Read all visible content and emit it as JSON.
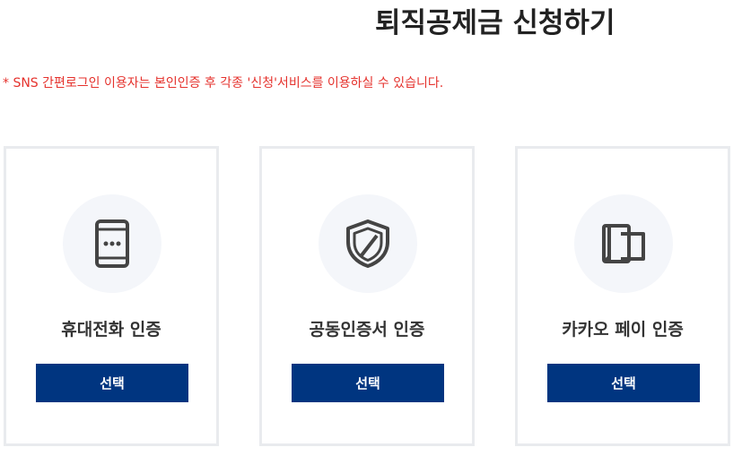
{
  "page": {
    "title": "퇴직공제금 신청하기",
    "notice": "* SNS 간편로그인 이용자는 본인인증 후 각종 '신청'서비스를 이용하실 수 있습니다."
  },
  "auth_options": [
    {
      "label": "휴대전화 인증",
      "button_label": "선택",
      "icon": "mobile-phone-icon"
    },
    {
      "label": "공동인증서 인증",
      "button_label": "선택",
      "icon": "shield-icon"
    },
    {
      "label": "카카오 페이 인증",
      "button_label": "선택",
      "icon": "kakao-pay-icon"
    }
  ],
  "colors": {
    "title": "#222222",
    "notice": "#e5322d",
    "button_bg": "#003580",
    "button_text": "#ffffff",
    "card_border": "#e9ebee",
    "icon_circle_bg": "#f4f6fa",
    "icon_stroke": "#444444"
  }
}
